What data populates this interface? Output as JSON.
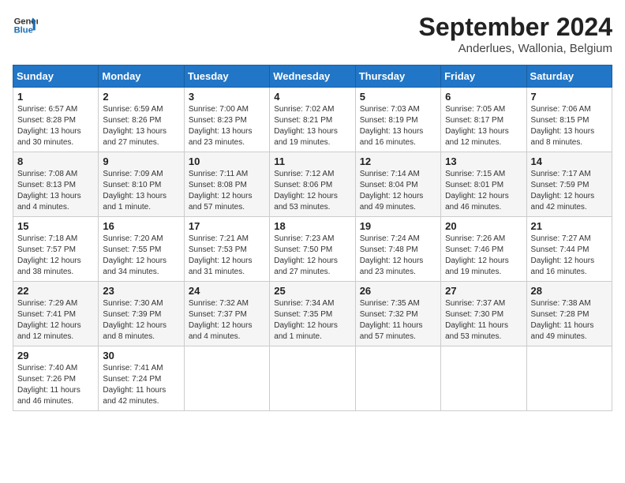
{
  "logo": {
    "line1": "General",
    "line2": "Blue"
  },
  "title": "September 2024",
  "location": "Anderlues, Wallonia, Belgium",
  "days_of_week": [
    "Sunday",
    "Monday",
    "Tuesday",
    "Wednesday",
    "Thursday",
    "Friday",
    "Saturday"
  ],
  "weeks": [
    [
      {
        "day": "1",
        "sunrise": "6:57 AM",
        "sunset": "8:28 PM",
        "daylight": "13 hours and 30 minutes."
      },
      {
        "day": "2",
        "sunrise": "6:59 AM",
        "sunset": "8:26 PM",
        "daylight": "13 hours and 27 minutes."
      },
      {
        "day": "3",
        "sunrise": "7:00 AM",
        "sunset": "8:23 PM",
        "daylight": "13 hours and 23 minutes."
      },
      {
        "day": "4",
        "sunrise": "7:02 AM",
        "sunset": "8:21 PM",
        "daylight": "13 hours and 19 minutes."
      },
      {
        "day": "5",
        "sunrise": "7:03 AM",
        "sunset": "8:19 PM",
        "daylight": "13 hours and 16 minutes."
      },
      {
        "day": "6",
        "sunrise": "7:05 AM",
        "sunset": "8:17 PM",
        "daylight": "13 hours and 12 minutes."
      },
      {
        "day": "7",
        "sunrise": "7:06 AM",
        "sunset": "8:15 PM",
        "daylight": "13 hours and 8 minutes."
      }
    ],
    [
      {
        "day": "8",
        "sunrise": "7:08 AM",
        "sunset": "8:13 PM",
        "daylight": "13 hours and 4 minutes."
      },
      {
        "day": "9",
        "sunrise": "7:09 AM",
        "sunset": "8:10 PM",
        "daylight": "13 hours and 1 minute."
      },
      {
        "day": "10",
        "sunrise": "7:11 AM",
        "sunset": "8:08 PM",
        "daylight": "12 hours and 57 minutes."
      },
      {
        "day": "11",
        "sunrise": "7:12 AM",
        "sunset": "8:06 PM",
        "daylight": "12 hours and 53 minutes."
      },
      {
        "day": "12",
        "sunrise": "7:14 AM",
        "sunset": "8:04 PM",
        "daylight": "12 hours and 49 minutes."
      },
      {
        "day": "13",
        "sunrise": "7:15 AM",
        "sunset": "8:01 PM",
        "daylight": "12 hours and 46 minutes."
      },
      {
        "day": "14",
        "sunrise": "7:17 AM",
        "sunset": "7:59 PM",
        "daylight": "12 hours and 42 minutes."
      }
    ],
    [
      {
        "day": "15",
        "sunrise": "7:18 AM",
        "sunset": "7:57 PM",
        "daylight": "12 hours and 38 minutes."
      },
      {
        "day": "16",
        "sunrise": "7:20 AM",
        "sunset": "7:55 PM",
        "daylight": "12 hours and 34 minutes."
      },
      {
        "day": "17",
        "sunrise": "7:21 AM",
        "sunset": "7:53 PM",
        "daylight": "12 hours and 31 minutes."
      },
      {
        "day": "18",
        "sunrise": "7:23 AM",
        "sunset": "7:50 PM",
        "daylight": "12 hours and 27 minutes."
      },
      {
        "day": "19",
        "sunrise": "7:24 AM",
        "sunset": "7:48 PM",
        "daylight": "12 hours and 23 minutes."
      },
      {
        "day": "20",
        "sunrise": "7:26 AM",
        "sunset": "7:46 PM",
        "daylight": "12 hours and 19 minutes."
      },
      {
        "day": "21",
        "sunrise": "7:27 AM",
        "sunset": "7:44 PM",
        "daylight": "12 hours and 16 minutes."
      }
    ],
    [
      {
        "day": "22",
        "sunrise": "7:29 AM",
        "sunset": "7:41 PM",
        "daylight": "12 hours and 12 minutes."
      },
      {
        "day": "23",
        "sunrise": "7:30 AM",
        "sunset": "7:39 PM",
        "daylight": "12 hours and 8 minutes."
      },
      {
        "day": "24",
        "sunrise": "7:32 AM",
        "sunset": "7:37 PM",
        "daylight": "12 hours and 4 minutes."
      },
      {
        "day": "25",
        "sunrise": "7:34 AM",
        "sunset": "7:35 PM",
        "daylight": "12 hours and 1 minute."
      },
      {
        "day": "26",
        "sunrise": "7:35 AM",
        "sunset": "7:32 PM",
        "daylight": "11 hours and 57 minutes."
      },
      {
        "day": "27",
        "sunrise": "7:37 AM",
        "sunset": "7:30 PM",
        "daylight": "11 hours and 53 minutes."
      },
      {
        "day": "28",
        "sunrise": "7:38 AM",
        "sunset": "7:28 PM",
        "daylight": "11 hours and 49 minutes."
      }
    ],
    [
      {
        "day": "29",
        "sunrise": "7:40 AM",
        "sunset": "7:26 PM",
        "daylight": "11 hours and 46 minutes."
      },
      {
        "day": "30",
        "sunrise": "7:41 AM",
        "sunset": "7:24 PM",
        "daylight": "11 hours and 42 minutes."
      },
      null,
      null,
      null,
      null,
      null
    ]
  ]
}
